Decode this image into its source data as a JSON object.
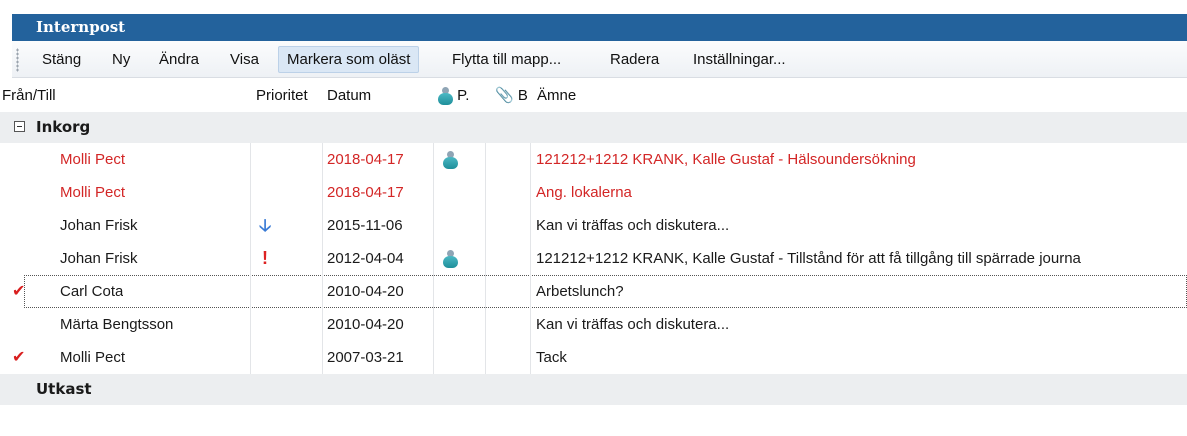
{
  "window": {
    "title": "Internpost"
  },
  "toolbar": {
    "buttons": [
      {
        "label": "Stäng"
      },
      {
        "label": "Ny"
      },
      {
        "label": "Ändra"
      },
      {
        "label": "Visa"
      },
      {
        "label": "Markera som oläst"
      },
      {
        "label": "Flytta till mapp..."
      },
      {
        "label": "Radera"
      },
      {
        "label": "Inställningar..."
      }
    ]
  },
  "columns": {
    "from_to": "Från/Till",
    "priority": "Prioritet",
    "date": "Datum",
    "patient_abbrev": "P.",
    "attachment_abbrev": "B",
    "subject": "Ämne"
  },
  "groups": [
    {
      "name": "Inkorg",
      "rows": [
        {
          "from": "Molli Pect",
          "priority": "",
          "date": "2018-04-17",
          "patient": true,
          "subject": "121212+1212 KRANK, Kalle Gustaf - Hälsoundersökning",
          "unread": true,
          "checked": false
        },
        {
          "from": "Molli Pect",
          "priority": "",
          "date": "2018-04-17",
          "patient": false,
          "subject": "Ang. lokalerna",
          "unread": true,
          "checked": false
        },
        {
          "from": "Johan Frisk",
          "priority": "low",
          "date": "2015-11-06",
          "patient": false,
          "subject": "Kan vi träffas och diskutera...",
          "unread": false,
          "checked": false
        },
        {
          "from": "Johan Frisk",
          "priority": "high",
          "date": "2012-04-04",
          "patient": true,
          "subject": "121212+1212 KRANK, Kalle Gustaf - Tillstånd för att få tillgång till spärrade journa",
          "unread": false,
          "checked": false
        },
        {
          "from": "Carl Cota",
          "priority": "",
          "date": "2010-04-20",
          "patient": false,
          "subject": "Arbetslunch?",
          "unread": false,
          "checked": true,
          "focused": true
        },
        {
          "from": "Märta Bengtsson",
          "priority": "",
          "date": "2010-04-20",
          "patient": false,
          "subject": "Kan vi träffas och diskutera...",
          "unread": false,
          "checked": false
        },
        {
          "from": "Molli Pect",
          "priority": "",
          "date": "2007-03-21",
          "patient": false,
          "subject": "Tack",
          "unread": false,
          "checked": true
        }
      ]
    },
    {
      "name": "Utkast",
      "rows": []
    }
  ],
  "icons": {
    "check": "checkmark-icon",
    "low_priority": "arrow-down-icon",
    "high_priority": "exclamation-icon",
    "patient": "person-icon",
    "attachment": "paperclip-icon"
  },
  "colors": {
    "titlebar": "#23629c",
    "unread_text": "#d32626",
    "check": "#d91f1f",
    "low_priority_arrow": "#3a7bd5"
  }
}
